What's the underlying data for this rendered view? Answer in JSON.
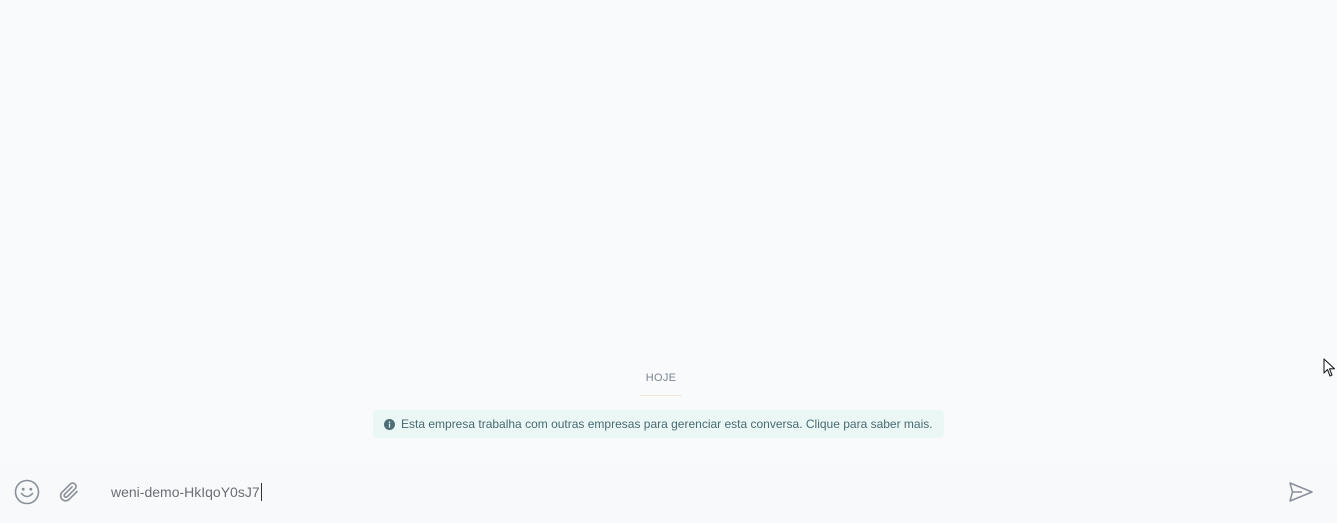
{
  "chat": {
    "date_divider": "HOJE",
    "system_notice": "Esta empresa trabalha com outras empresas para gerenciar esta conversa. Clique para saber mais.",
    "notice_icon": "info-icon"
  },
  "composer": {
    "emoji_icon": "emoji-icon",
    "attach_icon": "paperclip-icon",
    "input_value": "weni-demo-HkIqoY0sJ7",
    "send_icon": "send-icon"
  },
  "colors": {
    "background": "#f9fafc",
    "notice_background": "#eaf7f5",
    "notice_text": "#4a6a72",
    "icon_gray": "#8a9097"
  }
}
